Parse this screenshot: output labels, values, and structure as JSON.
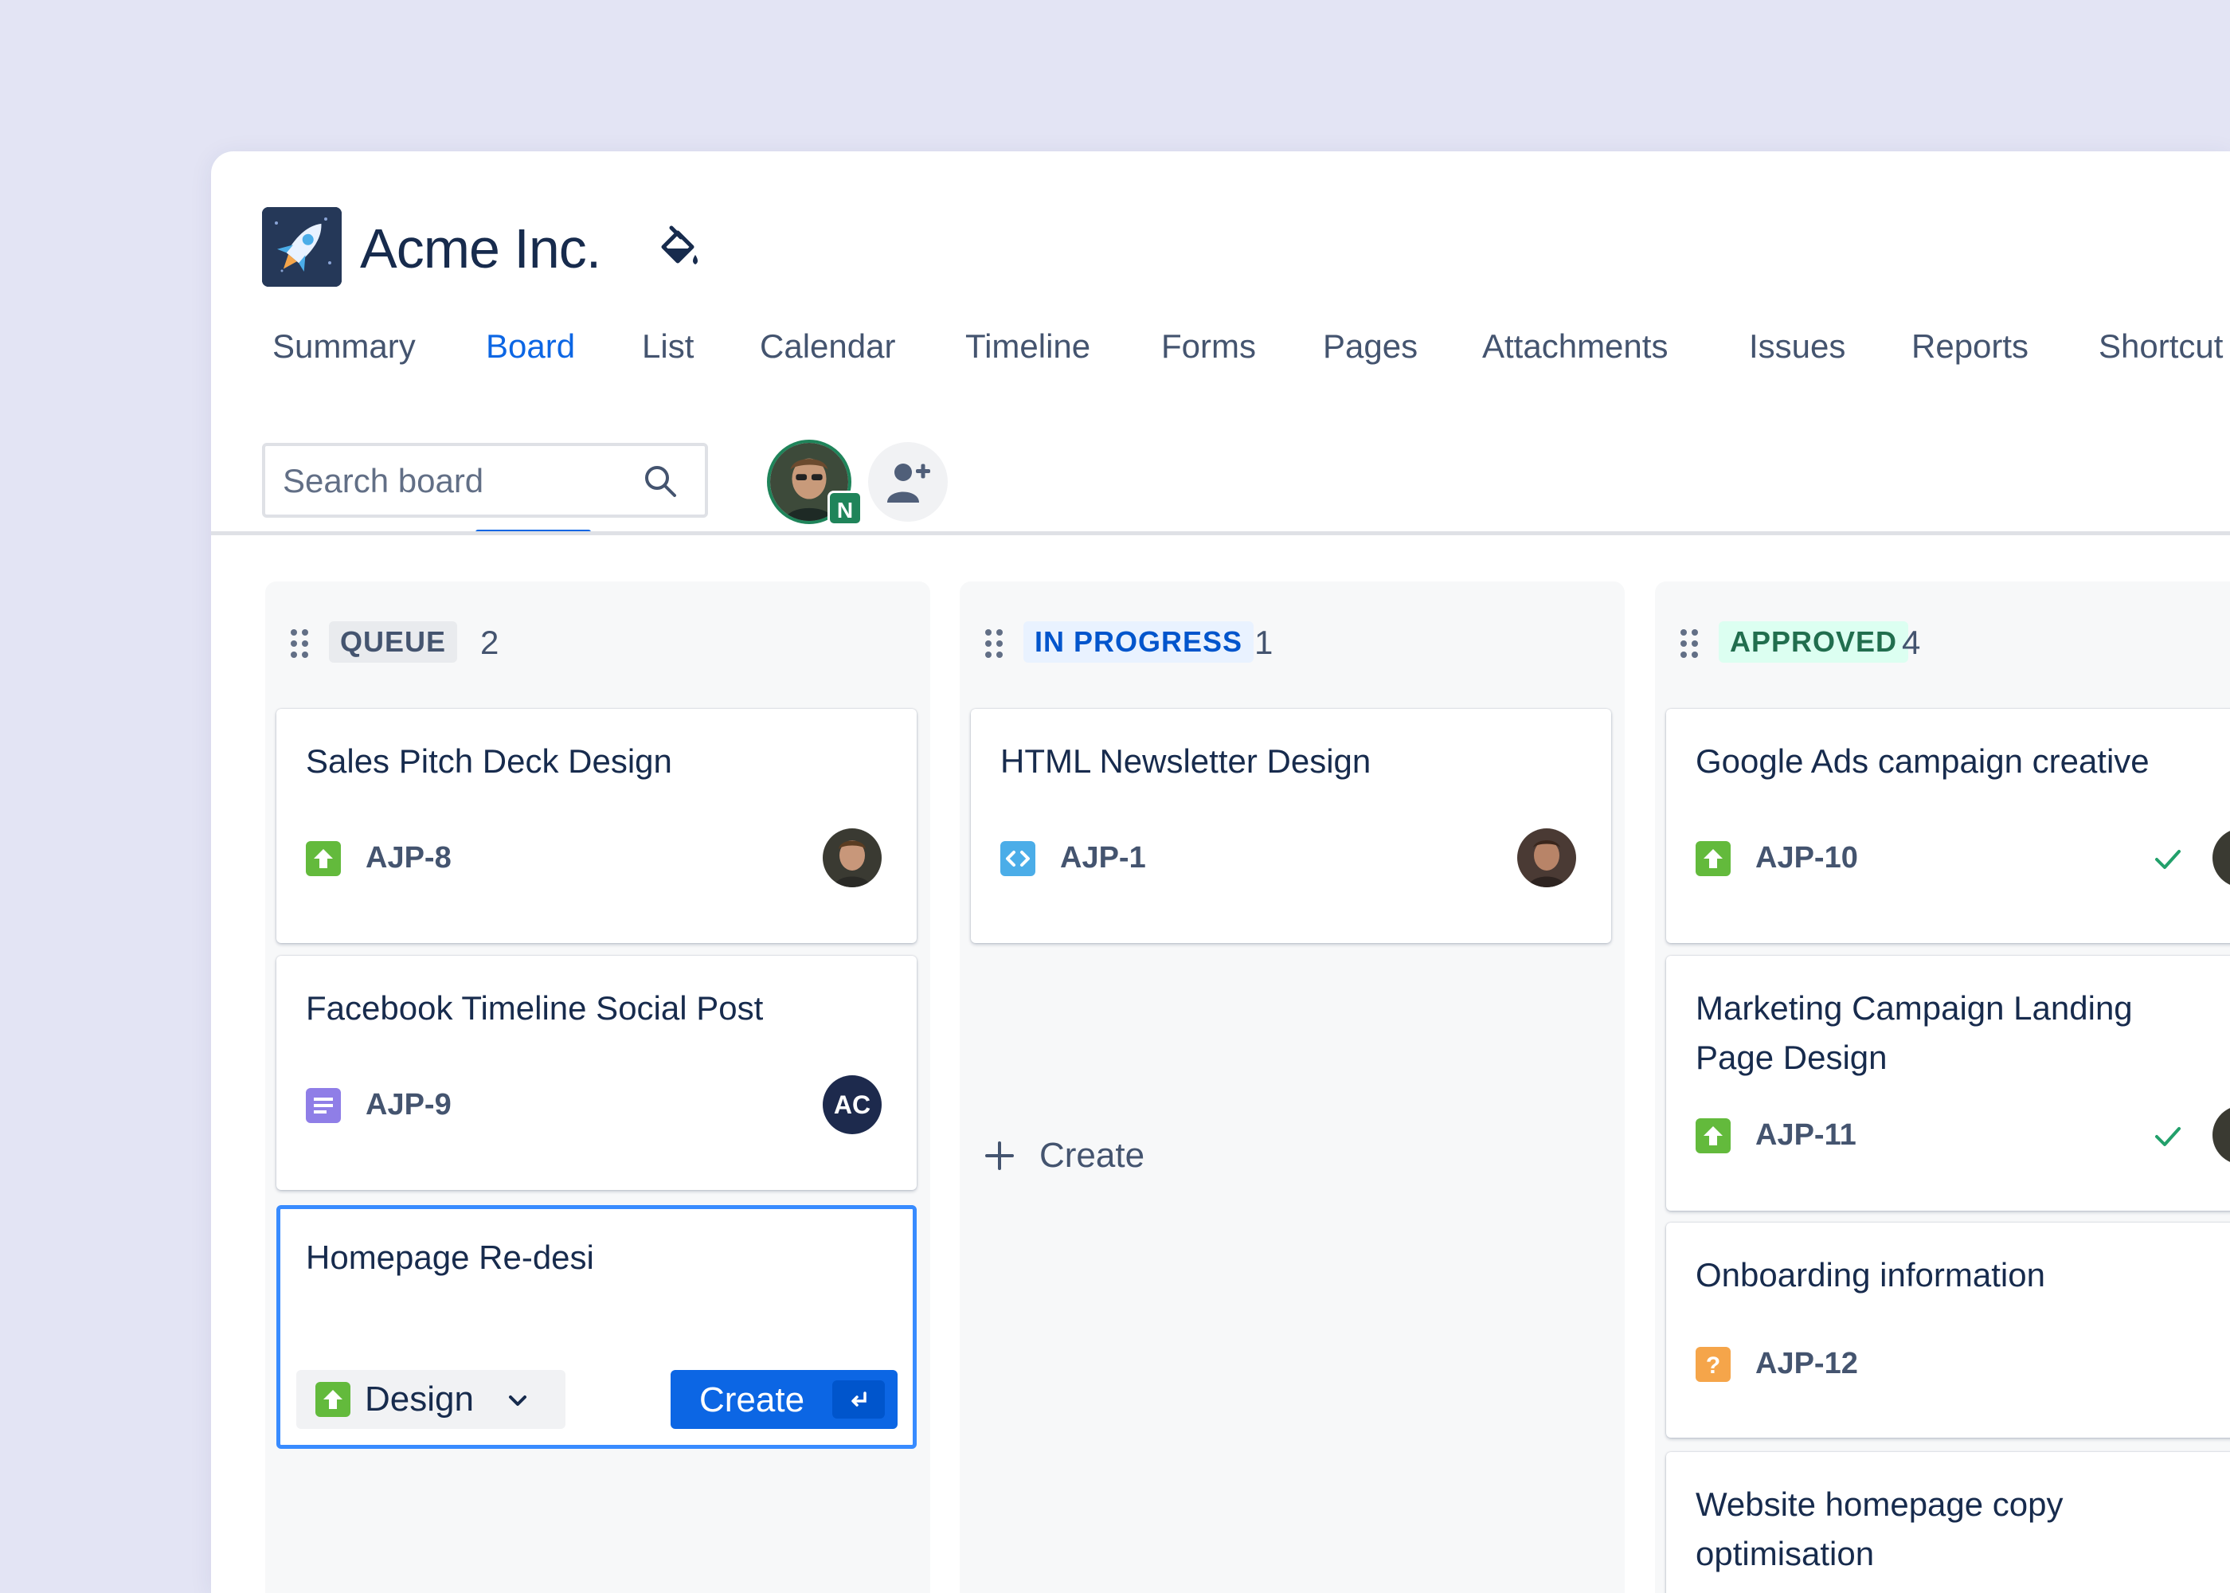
{
  "project": {
    "name": "Acme Inc.",
    "logo_icon": "rocket-icon",
    "theme_icon": "paint-bucket-icon"
  },
  "tabs": [
    {
      "label": "Summary",
      "active": false
    },
    {
      "label": "Board",
      "active": true
    },
    {
      "label": "List",
      "active": false
    },
    {
      "label": "Calendar",
      "active": false
    },
    {
      "label": "Timeline",
      "active": false
    },
    {
      "label": "Forms",
      "active": false
    },
    {
      "label": "Pages",
      "active": false
    },
    {
      "label": "Attachments",
      "active": false
    },
    {
      "label": "Issues",
      "active": false
    },
    {
      "label": "Reports",
      "active": false
    },
    {
      "label": "Shortcut",
      "active": false
    }
  ],
  "search": {
    "placeholder": "Search board",
    "value": ""
  },
  "members": {
    "current_user_badge": "N",
    "add_people_icon": "add-person-icon"
  },
  "colors": {
    "accent": "#0c66e4",
    "story": "#63ba3c",
    "task_purple": "#8f7ee7",
    "code_blue": "#4bade8",
    "question_orange": "#f5a54a"
  },
  "columns": [
    {
      "name": "QUEUE",
      "count": "2",
      "cards": [
        {
          "title": "Sales Pitch Deck Design",
          "key": "AJP-8",
          "type": "story",
          "assignee": "photo"
        },
        {
          "title": "Facebook Timeline Social Post",
          "key": "AJP-9",
          "type": "task",
          "assignee": "AC"
        }
      ],
      "draft": {
        "value": "Homepage Re-desi",
        "type_label": "Design",
        "create_label": "Create"
      }
    },
    {
      "name": "IN PROGRESS",
      "count": "1",
      "cards": [
        {
          "title": "HTML Newsletter Design",
          "key": "AJP-1",
          "type": "code",
          "assignee": "photo"
        }
      ],
      "create_label": "Create"
    },
    {
      "name": "APPROVED",
      "count": "4",
      "cards": [
        {
          "title": "Google Ads campaign creative",
          "key": "AJP-10",
          "type": "story",
          "done": true
        },
        {
          "title": "Marketing Campaign Landing Page Design",
          "key": "AJP-11",
          "type": "story",
          "done": true
        },
        {
          "title": "Onboarding information",
          "key": "AJP-12",
          "type": "question",
          "done": false
        },
        {
          "title": "Website homepage copy optimisation",
          "key": "",
          "type": "",
          "done": false
        }
      ]
    }
  ]
}
